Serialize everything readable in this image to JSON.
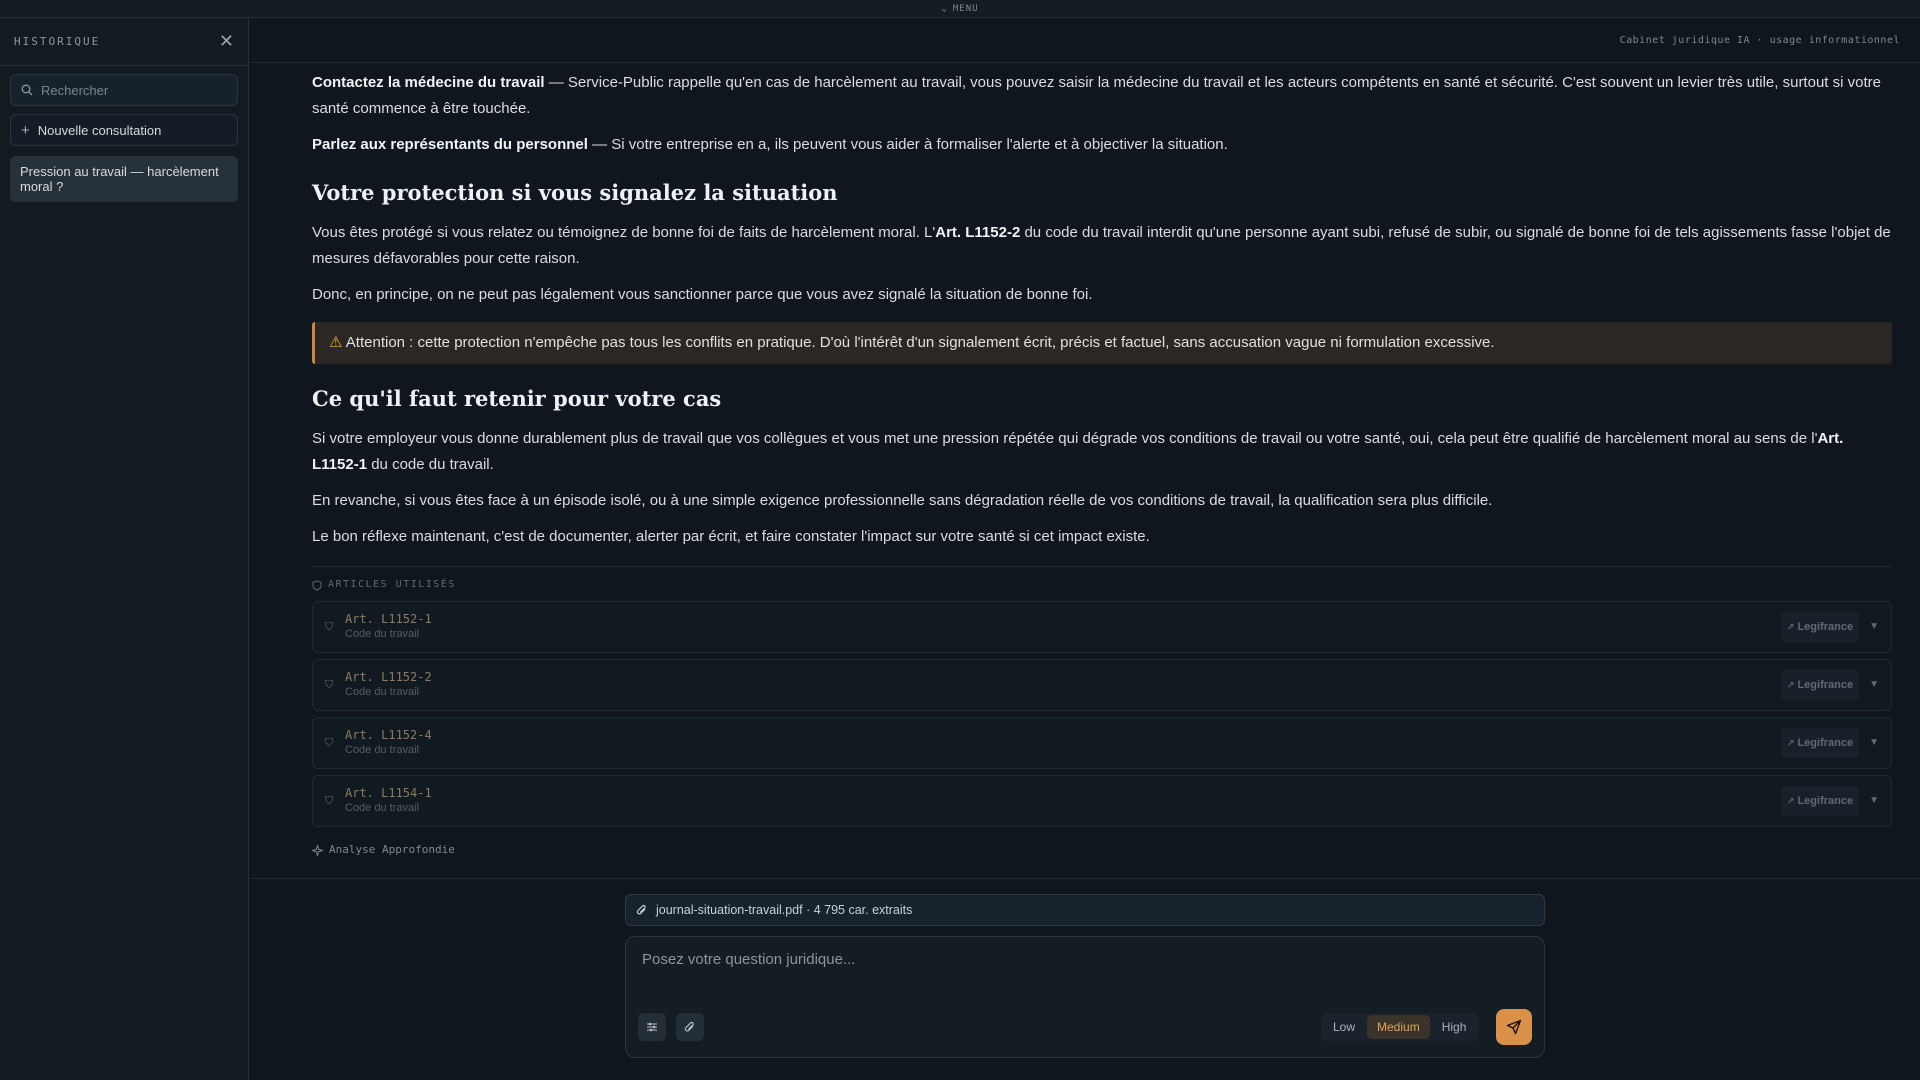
{
  "topbar": {
    "menu_label": "MENU"
  },
  "sidebar": {
    "title": "HISTORIQUE",
    "search_placeholder": "Rechercher",
    "new_label": "Nouvelle consultation",
    "items": [
      {
        "label": "Pression au travail — harcèlement moral ?"
      }
    ]
  },
  "header": {
    "subtitle": "Cabinet juridique IA · usage informationnel"
  },
  "content": {
    "p1_bold": "Contactez la médecine du travail",
    "p1_text": " — Service-Public rappelle qu'en cas de harcèlement au travail, vous pouvez saisir la médecine du travail et les acteurs compétents en santé et sécurité. C'est souvent un levier très utile, surtout si votre santé commence à être touchée.",
    "p2_bold": "Parlez aux représentants du personnel",
    "p2_text": " — Si votre entreprise en a, ils peuvent vous aider à formaliser l'alerte et à objectiver la situation.",
    "h_protection": "Votre protection si vous signalez la situation",
    "p3_a": "Vous êtes protégé si vous relatez ou témoignez de bonne foi de faits de harcèlement moral. L'",
    "p3_bold": "Art. L1152-2",
    "p3_b": " du code du travail interdit qu'une personne ayant subi, refusé de subir, ou signalé de bonne foi de tels agissements fasse l'objet de mesures défavorables pour cette raison.",
    "p4": "Donc, en principe, on ne peut pas légalement vous sanctionner parce que vous avez signalé la situation de bonne foi.",
    "alert_icon": "⚠",
    "alert_text": " Attention : cette protection n'empêche pas tous les conflits en pratique. D'où l'intérêt d'un signalement écrit, précis et factuel, sans accusation vague ni formulation excessive.",
    "h_retenir": "Ce qu'il faut retenir pour votre cas",
    "p5_a": "Si votre employeur vous donne durablement plus de travail que vos collègues et vous met une pression répétée qui dégrade vos conditions de travail ou votre santé, oui, cela peut être qualifié de harcèlement moral au sens de l'",
    "p5_bold": "Art. L1152-1",
    "p5_b": " du code du travail.",
    "p6": "En revanche, si vous êtes face à un épisode isolé, ou à une simple exigence professionnelle sans dégradation réelle de vos conditions de travail, la qualification sera plus difficile.",
    "p7": "Le bon réflexe maintenant, c'est de documenter, alerter par écrit, et faire constater l'impact sur votre santé si cet impact existe."
  },
  "articles": {
    "heading": "ARTICLES UTILISÉS",
    "legifrance_label": "Legifrance",
    "items": [
      {
        "name": "Art. L1152-1",
        "source": "Code du travail"
      },
      {
        "name": "Art. L1152-2",
        "source": "Code du travail"
      },
      {
        "name": "Art. L1152-4",
        "source": "Code du travail"
      },
      {
        "name": "Art. L1154-1",
        "source": "Code du travail"
      }
    ]
  },
  "deep_analysis": "Analyse Approfondie",
  "attachment": {
    "label": "journal-situation-travail.pdf · 4 795 car. extraits"
  },
  "composer": {
    "placeholder": "Posez votre question juridique...",
    "effort": [
      "Low",
      "Medium",
      "High"
    ],
    "effort_selected": "Medium"
  },
  "colors": {
    "accent": "#d9914a",
    "background": "#0f161d"
  }
}
